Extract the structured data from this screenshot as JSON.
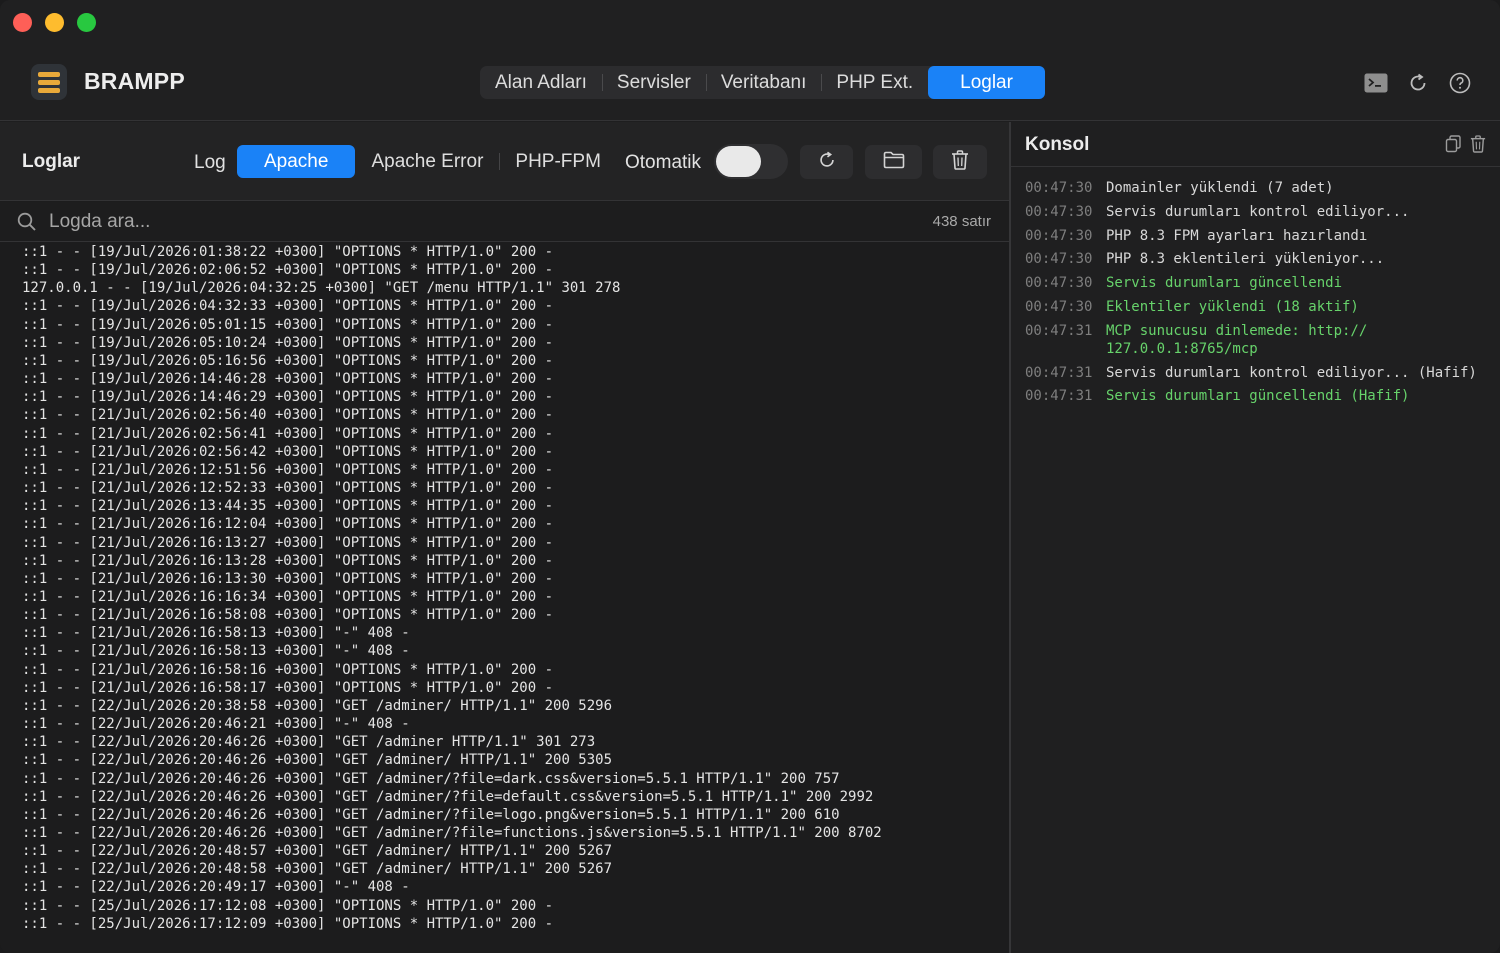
{
  "app": {
    "title": "BRAMPP"
  },
  "nav": {
    "tabs": [
      {
        "label": "Alan Adları"
      },
      {
        "label": "Servisler"
      },
      {
        "label": "Veritabanı"
      },
      {
        "label": "PHP Ext."
      },
      {
        "label": "Loglar",
        "active": true
      }
    ]
  },
  "header_icons": [
    "terminal-icon",
    "refresh-icon",
    "help-icon"
  ],
  "logs": {
    "title": "Loglar",
    "source_label": "Log",
    "sources": [
      {
        "label": "Apache",
        "active": true
      },
      {
        "label": "Apache Error"
      },
      {
        "label": "PHP-FPM"
      }
    ],
    "auto_label": "Otomatik",
    "auto_enabled": false,
    "search_placeholder": "Logda ara...",
    "row_count": "438 satır",
    "lines": [
      "::1 - - [19/Jul/2026:01:38:22 +0300] \"OPTIONS * HTTP/1.0\" 200 -",
      "::1 - - [19/Jul/2026:02:06:52 +0300] \"OPTIONS * HTTP/1.0\" 200 -",
      "127.0.0.1 - - [19/Jul/2026:04:32:25 +0300] \"GET /menu HTTP/1.1\" 301 278",
      "::1 - - [19/Jul/2026:04:32:33 +0300] \"OPTIONS * HTTP/1.0\" 200 -",
      "::1 - - [19/Jul/2026:05:01:15 +0300] \"OPTIONS * HTTP/1.0\" 200 -",
      "::1 - - [19/Jul/2026:05:10:24 +0300] \"OPTIONS * HTTP/1.0\" 200 -",
      "::1 - - [19/Jul/2026:05:16:56 +0300] \"OPTIONS * HTTP/1.0\" 200 -",
      "::1 - - [19/Jul/2026:14:46:28 +0300] \"OPTIONS * HTTP/1.0\" 200 -",
      "::1 - - [19/Jul/2026:14:46:29 +0300] \"OPTIONS * HTTP/1.0\" 200 -",
      "::1 - - [21/Jul/2026:02:56:40 +0300] \"OPTIONS * HTTP/1.0\" 200 -",
      "::1 - - [21/Jul/2026:02:56:41 +0300] \"OPTIONS * HTTP/1.0\" 200 -",
      "::1 - - [21/Jul/2026:02:56:42 +0300] \"OPTIONS * HTTP/1.0\" 200 -",
      "::1 - - [21/Jul/2026:12:51:56 +0300] \"OPTIONS * HTTP/1.0\" 200 -",
      "::1 - - [21/Jul/2026:12:52:33 +0300] \"OPTIONS * HTTP/1.0\" 200 -",
      "::1 - - [21/Jul/2026:13:44:35 +0300] \"OPTIONS * HTTP/1.0\" 200 -",
      "::1 - - [21/Jul/2026:16:12:04 +0300] \"OPTIONS * HTTP/1.0\" 200 -",
      "::1 - - [21/Jul/2026:16:13:27 +0300] \"OPTIONS * HTTP/1.0\" 200 -",
      "::1 - - [21/Jul/2026:16:13:28 +0300] \"OPTIONS * HTTP/1.0\" 200 -",
      "::1 - - [21/Jul/2026:16:13:30 +0300] \"OPTIONS * HTTP/1.0\" 200 -",
      "::1 - - [21/Jul/2026:16:16:34 +0300] \"OPTIONS * HTTP/1.0\" 200 -",
      "::1 - - [21/Jul/2026:16:58:08 +0300] \"OPTIONS * HTTP/1.0\" 200 -",
      "::1 - - [21/Jul/2026:16:58:13 +0300] \"-\" 408 -",
      "::1 - - [21/Jul/2026:16:58:13 +0300] \"-\" 408 -",
      "::1 - - [21/Jul/2026:16:58:16 +0300] \"OPTIONS * HTTP/1.0\" 200 -",
      "::1 - - [21/Jul/2026:16:58:17 +0300] \"OPTIONS * HTTP/1.0\" 200 -",
      "::1 - - [22/Jul/2026:20:38:58 +0300] \"GET /adminer/ HTTP/1.1\" 200 5296",
      "::1 - - [22/Jul/2026:20:46:21 +0300] \"-\" 408 -",
      "::1 - - [22/Jul/2026:20:46:26 +0300] \"GET /adminer HTTP/1.1\" 301 273",
      "::1 - - [22/Jul/2026:20:46:26 +0300] \"GET /adminer/ HTTP/1.1\" 200 5305",
      "::1 - - [22/Jul/2026:20:46:26 +0300] \"GET /adminer/?file=dark.css&version=5.5.1 HTTP/1.1\" 200 757",
      "::1 - - [22/Jul/2026:20:46:26 +0300] \"GET /adminer/?file=default.css&version=5.5.1 HTTP/1.1\" 200 2992",
      "::1 - - [22/Jul/2026:20:46:26 +0300] \"GET /adminer/?file=logo.png&version=5.5.1 HTTP/1.1\" 200 610",
      "::1 - - [22/Jul/2026:20:46:26 +0300] \"GET /adminer/?file=functions.js&version=5.5.1 HTTP/1.1\" 200 8702",
      "::1 - - [22/Jul/2026:20:48:57 +0300] \"GET /adminer/ HTTP/1.1\" 200 5267",
      "::1 - - [22/Jul/2026:20:48:58 +0300] \"GET /adminer/ HTTP/1.1\" 200 5267",
      "::1 - - [22/Jul/2026:20:49:17 +0300] \"-\" 408 -",
      "::1 - - [25/Jul/2026:17:12:08 +0300] \"OPTIONS * HTTP/1.0\" 200 -",
      "::1 - - [25/Jul/2026:17:12:09 +0300] \"OPTIONS * HTTP/1.0\" 200 -"
    ]
  },
  "console": {
    "title": "Konsol",
    "entries": [
      {
        "time": "00:47:30",
        "message": "Domainler yüklendi (7 adet)",
        "status": "info"
      },
      {
        "time": "00:47:30",
        "message": "Servis durumları kontrol ediliyor...",
        "status": "info"
      },
      {
        "time": "00:47:30",
        "message": "PHP 8.3 FPM ayarları hazırlandı",
        "status": "info"
      },
      {
        "time": "00:47:30",
        "message": "PHP 8.3 eklentileri yükleniyor...",
        "status": "info"
      },
      {
        "time": "00:47:30",
        "message": "Servis durumları güncellendi",
        "status": "success"
      },
      {
        "time": "00:47:30",
        "message": "Eklentiler yüklendi (18 aktif)",
        "status": "success"
      },
      {
        "time": "00:47:31",
        "message": "MCP sunucusu dinlemede: http://\n127.0.0.1:8765/mcp",
        "status": "success"
      },
      {
        "time": "00:47:31",
        "message": "Servis durumları kontrol ediliyor... (Hafif)",
        "status": "info"
      },
      {
        "time": "00:47:31",
        "message": "Servis durumları güncellendi (Hafif)",
        "status": "success"
      }
    ]
  },
  "colors": {
    "accent": "#1a82f7",
    "success": "#67d36b",
    "background": "#1e1e1f"
  }
}
